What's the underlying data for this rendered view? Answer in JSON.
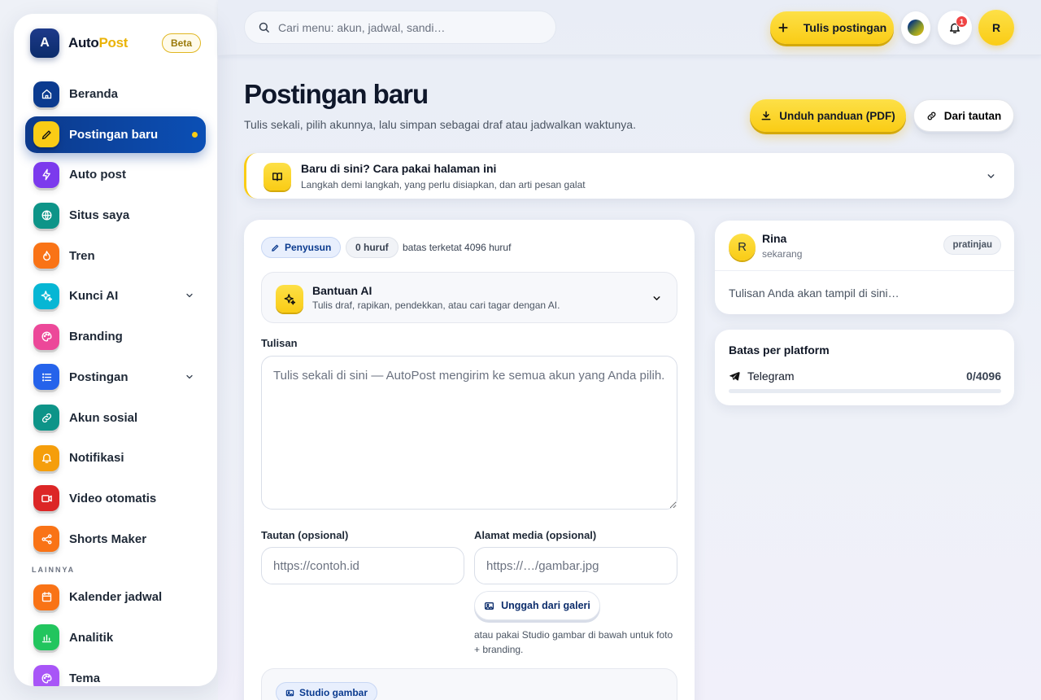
{
  "sidebar": {
    "brand_letter": "A",
    "brand_part1": "Auto",
    "brand_part2": "Post",
    "badge": "Beta",
    "items": [
      {
        "label": "Beranda",
        "icon": "home-icon",
        "color": "#0b3b8f"
      },
      {
        "label": "Postingan baru",
        "icon": "pencil-icon",
        "color": "#facc15",
        "active": true
      },
      {
        "label": "Auto post",
        "icon": "bolt-icon",
        "color": "#7c3aed"
      },
      {
        "label": "Situs saya",
        "icon": "globe-icon",
        "color": "#0d9488"
      },
      {
        "label": "Tren",
        "icon": "flame-icon",
        "color": "#f97316"
      },
      {
        "label": "Kunci AI",
        "icon": "sparkle-icon",
        "color": "#06b6d4",
        "expandable": true
      },
      {
        "label": "Branding",
        "icon": "palette-icon",
        "color": "#ec4899"
      },
      {
        "label": "Postingan",
        "icon": "list-icon",
        "color": "#2563eb",
        "expandable": true
      },
      {
        "label": "Akun sosial",
        "icon": "link-icon",
        "color": "#0d9488"
      },
      {
        "label": "Notifikasi",
        "icon": "bell-icon",
        "color": "#f59e0b"
      },
      {
        "label": "Video otomatis",
        "icon": "video-icon",
        "color": "#dc2626"
      },
      {
        "label": "Shorts Maker",
        "icon": "share-icon",
        "color": "#f97316"
      }
    ],
    "section_other": "LAINNYA",
    "other_items": [
      {
        "label": "Kalender jadwal",
        "icon": "calendar-icon",
        "color": "#f97316"
      },
      {
        "label": "Analitik",
        "icon": "chart-icon",
        "color": "#22c55e"
      },
      {
        "label": "Tema",
        "icon": "palette-icon",
        "color": "#a855f7"
      }
    ]
  },
  "topbar": {
    "search_placeholder": "Cari menu: akun, jadwal, sandi…",
    "write_button": "Tulis postingan",
    "notification_count": "1",
    "avatar_letter": "R"
  },
  "header": {
    "title": "Postingan baru",
    "subtitle": "Tulis sekali, pilih akunnya, lalu simpan sebagai draf atau jadwalkan waktunya.",
    "download_button": "Unduh panduan (PDF)",
    "from_link_button": "Dari tautan"
  },
  "banner": {
    "title": "Baru di sini? Cara pakai halaman ini",
    "subtitle": "Langkah demi langkah, yang perlu disiapkan, dan arti pesan galat"
  },
  "composer": {
    "mode_label": "Penyusun",
    "char_count": "0 huruf",
    "limit_text": "batas terketat 4096 huruf",
    "ai_title": "Bantuan AI",
    "ai_subtitle": "Tulis draf, rapikan, pendekkan, atau cari tagar dengan AI.",
    "text_label": "Tulisan",
    "text_placeholder": "Tulis sekali di sini — AutoPost mengirim ke semua akun yang Anda pilih.",
    "link_label": "Tautan (opsional)",
    "link_placeholder": "https://contoh.id",
    "media_label": "Alamat media (opsional)",
    "media_placeholder": "https://…/gambar.jpg",
    "upload_button": "Unggah dari galeri",
    "media_hint": "atau pakai Studio gambar di bawah untuk foto + branding.",
    "studio_label": "Studio gambar"
  },
  "preview": {
    "avatar_letter": "R",
    "name": "Rina",
    "time": "sekarang",
    "tag": "pratinjau",
    "body": "Tulisan Anda akan tampil di sini…"
  },
  "limits": {
    "title": "Batas per platform",
    "platform": "Telegram",
    "count": "0/4096",
    "fill_fraction": 0
  },
  "colors": {
    "accent_yellow": "#facc15",
    "brand_blue": "#0b3b8f",
    "danger": "#ef4444"
  }
}
